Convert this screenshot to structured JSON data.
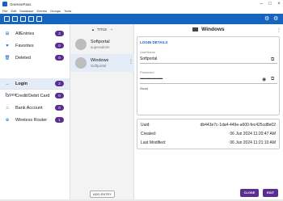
{
  "window": {
    "title": "OneKeePass",
    "minimize": "–",
    "maximize": "□",
    "close": "×"
  },
  "menu": [
    "File",
    "Edit",
    "Database",
    "Entries",
    "Groups",
    "Tools"
  ],
  "toolbar": {
    "icons": [
      "folder-icon",
      "save-icon",
      "lock-icon",
      "add-icon",
      "add-entry-icon"
    ],
    "settings_glyph": "⚙",
    "gear_glyph": "⚙"
  },
  "sidebar": {
    "items": [
      {
        "label": "AllEntries",
        "count": "3",
        "icon": "⊞"
      },
      {
        "label": "Favorites",
        "count": "0",
        "icon": "♥"
      },
      {
        "label": "Deleted",
        "count": "0",
        "icon": "🗑"
      }
    ],
    "types_heading": "Types",
    "types_chevron": "⌄",
    "types": [
      {
        "label": "Login",
        "count": "2",
        "icon": "→"
      },
      {
        "label": "Credit/Debit Card",
        "count": "0",
        "icon": "▭"
      },
      {
        "label": "Bank Account",
        "count": "0",
        "icon": "⌂"
      },
      {
        "label": "Wireless Router",
        "count": "1",
        "icon": "⊕"
      }
    ]
  },
  "list": {
    "sort_label": "TITLE",
    "sort_arrow": "▲",
    "sort_chevron": "⌄",
    "entries": [
      {
        "title": "Softportal",
        "subtitle": "superadmin"
      },
      {
        "title": "Windows",
        "subtitle": "Softportal"
      }
    ],
    "add_entry_label": "ADD ENTRY"
  },
  "detail": {
    "title": "Windows",
    "login_section_title": "LOGIN DETAILS",
    "username_label": "UserName",
    "username_value": "Softportal",
    "password_label": "Password",
    "password_value": "••••••••••••••••••••••••••",
    "password_strength": "Good",
    "uuid_label": "Uuid:",
    "uuid_value": "db443e7c-1da4-449e-a600-fec425cd8e02",
    "created_label": "Created:",
    "created_value": "06 Jun 2024 11:20:47 AM",
    "modified_label": "Last Modified:",
    "modified_value": "06 Jun 2024 11:21:10 AM",
    "close_label": "CLOSE",
    "edit_label": "EDIT"
  },
  "colors": {
    "accent": "#1565c0",
    "badge": "#5a2d91"
  }
}
